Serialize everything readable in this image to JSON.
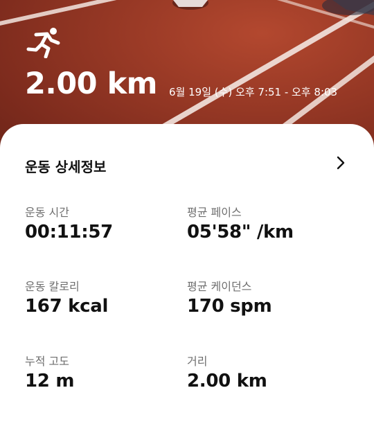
{
  "header": {
    "activity_icon": "running-person-icon",
    "distance": "2.00 km",
    "date_range": "6월 19일 (수) 오후 7:51 - 오후 8:03"
  },
  "details": {
    "title": "운동 상세정보",
    "chevron_icon": "chevron-right-icon",
    "stats": [
      {
        "label": "운동 시간",
        "value": "00:11:57"
      },
      {
        "label": "평균 페이스",
        "value": "05'58\" /km"
      },
      {
        "label": "운동 칼로리",
        "value": "167 kcal"
      },
      {
        "label": "평균 케이던스",
        "value": "170 spm"
      },
      {
        "label": "누적 고도",
        "value": "12 m"
      },
      {
        "label": "거리",
        "value": "2.00 km"
      }
    ]
  },
  "colors": {
    "track": "#8f3422",
    "lane_line": "#f3e6e0",
    "card_bg": "#ffffff",
    "label_gray": "#6e6e6e"
  }
}
